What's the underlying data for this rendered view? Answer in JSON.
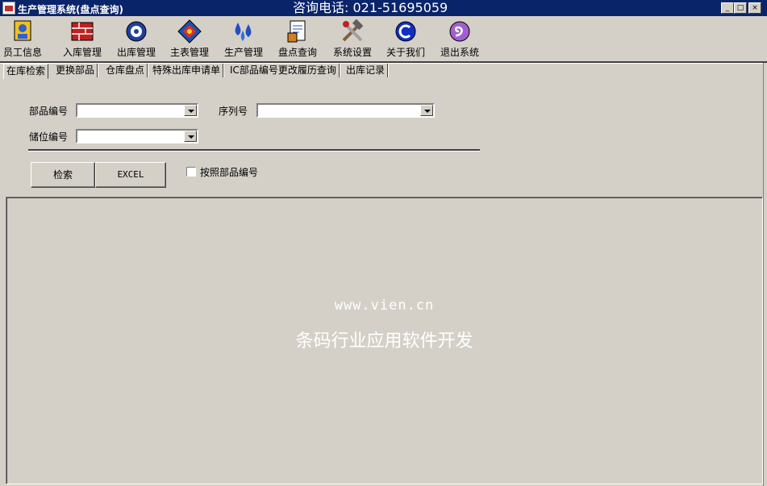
{
  "window": {
    "title": "生产管理系统(盘点查询)",
    "hotline": "咨询电话: 021-51695059",
    "controls": {
      "minimize": "_",
      "maximize": "□",
      "close": "×"
    }
  },
  "toolbar": {
    "items": [
      {
        "label": "员工信息",
        "icon": "employee-icon"
      },
      {
        "label": "入库管理",
        "icon": "warehouse-in-icon"
      },
      {
        "label": "出库管理",
        "icon": "warehouse-out-icon"
      },
      {
        "label": "主表管理",
        "icon": "master-table-icon"
      },
      {
        "label": "生产管理",
        "icon": "production-icon"
      },
      {
        "label": "盘点查询",
        "icon": "inventory-query-icon"
      },
      {
        "label": "系统设置",
        "icon": "settings-tools-icon"
      },
      {
        "label": "关于我们",
        "icon": "about-icon"
      },
      {
        "label": "退出系统",
        "icon": "exit-icon"
      }
    ]
  },
  "tabs": [
    {
      "label": "在库检索",
      "active": true
    },
    {
      "label": "更换部品",
      "active": false
    },
    {
      "label": "仓库盘点",
      "active": false
    },
    {
      "label": "特殊出库申请单",
      "active": false
    },
    {
      "label": "IC部品编号更改履历查询",
      "active": false
    },
    {
      "label": "出库记录",
      "active": false
    }
  ],
  "form": {
    "part_no_label": "部品编号",
    "part_no_value": "",
    "serial_label": "序列号",
    "serial_value": "",
    "location_label": "储位编号",
    "location_value": "",
    "search_button": "检索",
    "excel_button": "EXCEL",
    "checkbox_label": "按照部品编号",
    "checkbox_checked": false
  },
  "watermark": {
    "url": "www.vien.cn",
    "text": "条码行业应用软件开发"
  },
  "colors": {
    "window_bg": "#d4d0c8",
    "titlebar_bg": "#0a246a",
    "titlebar_text": "#ffffff"
  }
}
